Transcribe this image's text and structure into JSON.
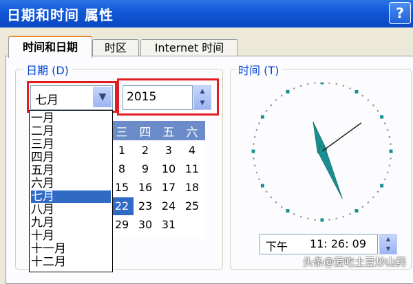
{
  "window": {
    "title": "日期和时间 属性",
    "help": "?"
  },
  "tabs": [
    "时间和日期",
    "时区",
    "Internet 时间"
  ],
  "date_group": {
    "label": "日期 (D)"
  },
  "month_select": {
    "value": "七月"
  },
  "year_input": {
    "value": "2015"
  },
  "month_list": [
    "一月",
    "二月",
    "三月",
    "四月",
    "五月",
    "六月",
    "七月",
    "八月",
    "九月",
    "十月",
    "十一月",
    "十二月"
  ],
  "month_selected_index": 6,
  "calendar": {
    "weekdays": [
      "三",
      "四",
      "五",
      "六"
    ],
    "rows": [
      [
        "1",
        "2",
        "3",
        "4"
      ],
      [
        "8",
        "9",
        "10",
        "11"
      ],
      [
        "15",
        "16",
        "17",
        "18"
      ],
      [
        "22",
        "23",
        "24",
        "25"
      ],
      [
        "29",
        "30",
        "31",
        ""
      ]
    ],
    "selected": "22"
  },
  "time_group": {
    "label": "时间 (T)"
  },
  "time_input": {
    "ampm": "下午",
    "time": "11: 26: 09"
  },
  "clock": {
    "hour": 11,
    "minute": 26,
    "second": 9
  },
  "watermark": "头条@爱吃土豆炒山药",
  "colors": {
    "titlebar": "#0b47c2",
    "highlight": "#e11d22",
    "selection": "#316ac5",
    "clock_hands": "#1b8f8f"
  }
}
